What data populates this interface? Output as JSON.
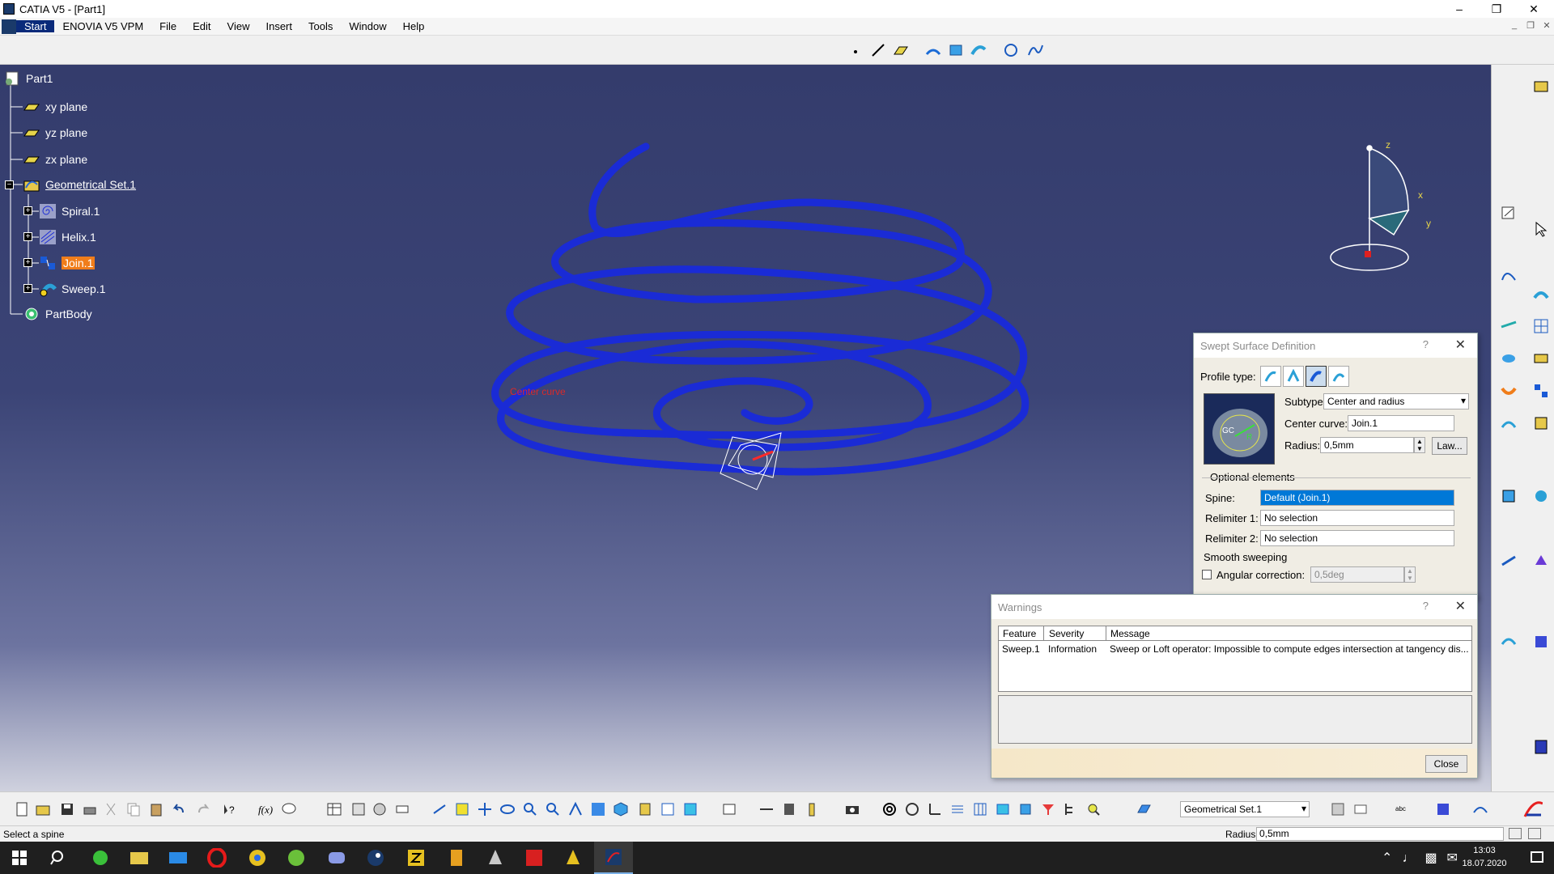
{
  "window": {
    "title": "CATIA V5 - [Part1]"
  },
  "menu": {
    "items": [
      "Start",
      "ENOVIA V5 VPM",
      "File",
      "Edit",
      "View",
      "Insert",
      "Tools",
      "Window",
      "Help"
    ]
  },
  "tree": {
    "root": "Part1",
    "planes": [
      "xy plane",
      "yz plane",
      "zx plane"
    ],
    "geoset": "Geometrical Set.1",
    "children": [
      "Spiral.1",
      "Helix.1",
      "Join.1",
      "Sweep.1"
    ],
    "body": "PartBody"
  },
  "viewport": {
    "curve_label": "Center curve",
    "axes": {
      "z": "z",
      "x": "x",
      "y": "y"
    }
  },
  "swept": {
    "title": "Swept Surface Definition",
    "help": "?",
    "profile_type_label": "Profile type:",
    "subtype_label": "Subtype:",
    "subtype_value": "Center and radius",
    "center_curve_label": "Center curve:",
    "center_curve_value": "Join.1",
    "radius_label": "Radius:",
    "radius_value": "0,5mm",
    "law_button": "Law...",
    "optional_label": "Optional elements",
    "spine_label": "Spine:",
    "spine_value": "Default (Join.1)",
    "relimiter1_label": "Relimiter 1:",
    "relimiter1_value": "No selection",
    "relimiter2_label": "Relimiter 2:",
    "relimiter2_value": "No selection",
    "smooth_label": "Smooth sweeping",
    "angular_label": "Angular correction:",
    "angular_value": "0,5deg",
    "diagram_gc": "GC",
    "diagram_r": "R"
  },
  "warnings": {
    "title": "Warnings",
    "help": "?",
    "columns": [
      "Feature",
      "Severity",
      "Message"
    ],
    "rows": [
      {
        "feature": "Sweep.1",
        "severity": "Information",
        "message": "Sweep or Loft operator: Impossible to compute edges intersection at tangency dis..."
      }
    ],
    "close_button": "Close"
  },
  "bottom": {
    "geoset_select": "Geometrical Set.1"
  },
  "status": {
    "prompt": "Select a spine",
    "radius_label": "Radius",
    "radius_value": "0,5mm"
  },
  "taskbar": {
    "time": "13:03",
    "date": "18.07.2020"
  },
  "colors": {
    "viewport_top": "#343c6c",
    "curve_outer": "#1a2bd6",
    "curve_inner": "#ff3b2a",
    "highlight": "#f07d1a",
    "selection": "#0078d7"
  }
}
